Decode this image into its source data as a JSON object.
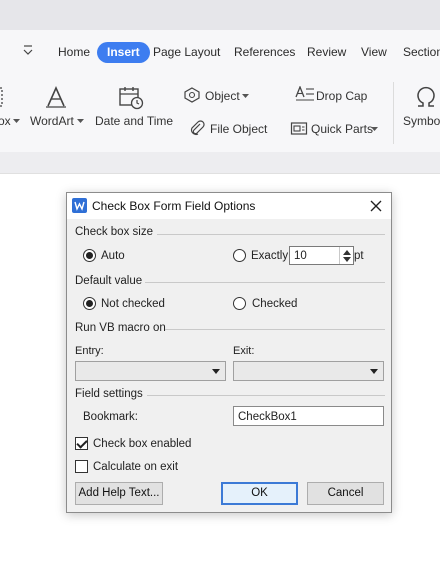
{
  "ribbon_tabs": {
    "home": "Home",
    "insert": "Insert",
    "page_layout": "Page Layout",
    "references": "References",
    "review": "Review",
    "view": "View",
    "section": "Section"
  },
  "ribbon": {
    "textbox_partial": "ox",
    "wordart": "WordArt",
    "date_time": "Date and Time",
    "object": "Object",
    "file_object": "File Object",
    "drop_cap": "Drop Cap",
    "quick_parts": "Quick Parts",
    "symbol": "Symbol"
  },
  "dialog": {
    "title": "Check Box Form Field Options",
    "size_group": "Check box size",
    "size_auto": "Auto",
    "size_exactly": "Exactly",
    "size_value": "10",
    "size_unit": "pt",
    "size_selected": "Auto",
    "default_group": "Default value",
    "not_checked": "Not checked",
    "checked": "Checked",
    "default_selected": "Not checked",
    "macro_group": "Run VB macro on",
    "entry_label": "Entry:",
    "exit_label": "Exit:",
    "entry_value": "",
    "exit_value": "",
    "field_group": "Field settings",
    "bookmark_label": "Bookmark:",
    "bookmark_value": "CheckBox1",
    "enabled_label": "Check box enabled",
    "enabled_checked": true,
    "calc_label": "Calculate on exit",
    "calc_checked": false,
    "help_button": "Add Help Text...",
    "ok_button": "OK",
    "cancel_button": "Cancel"
  },
  "colors": {
    "accent": "#3d7df0",
    "dialog_bg": "#f0f0f0",
    "default_button_border": "#3c7ad6"
  }
}
